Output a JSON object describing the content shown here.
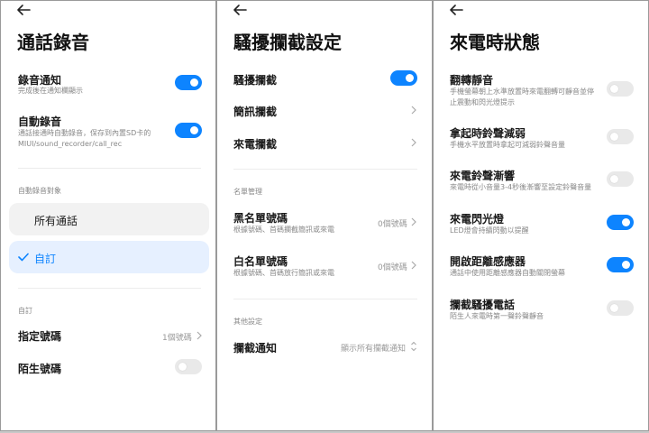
{
  "accent_color": "#0d84ff",
  "panel_call_recording": {
    "title": "通話錄音",
    "items": [
      {
        "label": "錄音通知",
        "sub": "完成後在通知欄顯示",
        "on": true
      },
      {
        "label": "自動錄音",
        "sub1": "通話接通時自動錄音，保存到內置SD卡的",
        "sub2": "MIUI/sound_recorder/call_rec",
        "on": true
      }
    ],
    "section_targets": "自動錄音對象",
    "choice_all": "所有通話",
    "choice_custom": "自訂",
    "section_custom": "自訂",
    "specified_numbers": {
      "label": "指定號碼",
      "value": "1個號碼"
    },
    "unknown_numbers": {
      "label": "陌生號碼",
      "on": false
    }
  },
  "panel_harass": {
    "title": "騷擾攔截設定",
    "harass_block": {
      "label": "騷擾攔截",
      "on": true
    },
    "sms_block": "簡訊攔截",
    "call_block": "來電攔截",
    "section_list": "名單管理",
    "blacklist": {
      "label": "黑名單號碼",
      "sub": "根據號碼、首碼攔截簡訊或來電",
      "value": "0個號碼"
    },
    "whitelist": {
      "label": "白名單號碼",
      "sub": "根據號碼、首碼放行簡訊或來電",
      "value": "0個號碼"
    },
    "section_other": "其他設定",
    "block_notify": {
      "label": "攔截通知",
      "value": "顯示所有攔截通知"
    }
  },
  "panel_incoming": {
    "title": "來電時狀態",
    "items": [
      {
        "label": "翻轉靜音",
        "sub1": "手機螢幕朝上水準放置時來電翻轉可靜音並停",
        "sub2": "止震動和閃光燈提示",
        "on": false
      },
      {
        "label": "拿起時鈴聲減弱",
        "sub1": "手機水平放置時拿起可減弱鈴聲音量",
        "on": false
      },
      {
        "label": "來電鈴聲漸響",
        "sub1": "來電時從小音量3-4秒後漸響至設定鈴聲音量",
        "on": false
      },
      {
        "label": "來電閃光燈",
        "sub1": "LED燈會持續閃動以提醒",
        "on": true
      },
      {
        "label": "開啟距離感應器",
        "sub1": "通話中使用距離感應器自動關閉螢幕",
        "on": true
      },
      {
        "label": "攔截騷擾電話",
        "sub1": "陌生人來電時第一聲鈴聲靜音",
        "on": false
      }
    ]
  }
}
